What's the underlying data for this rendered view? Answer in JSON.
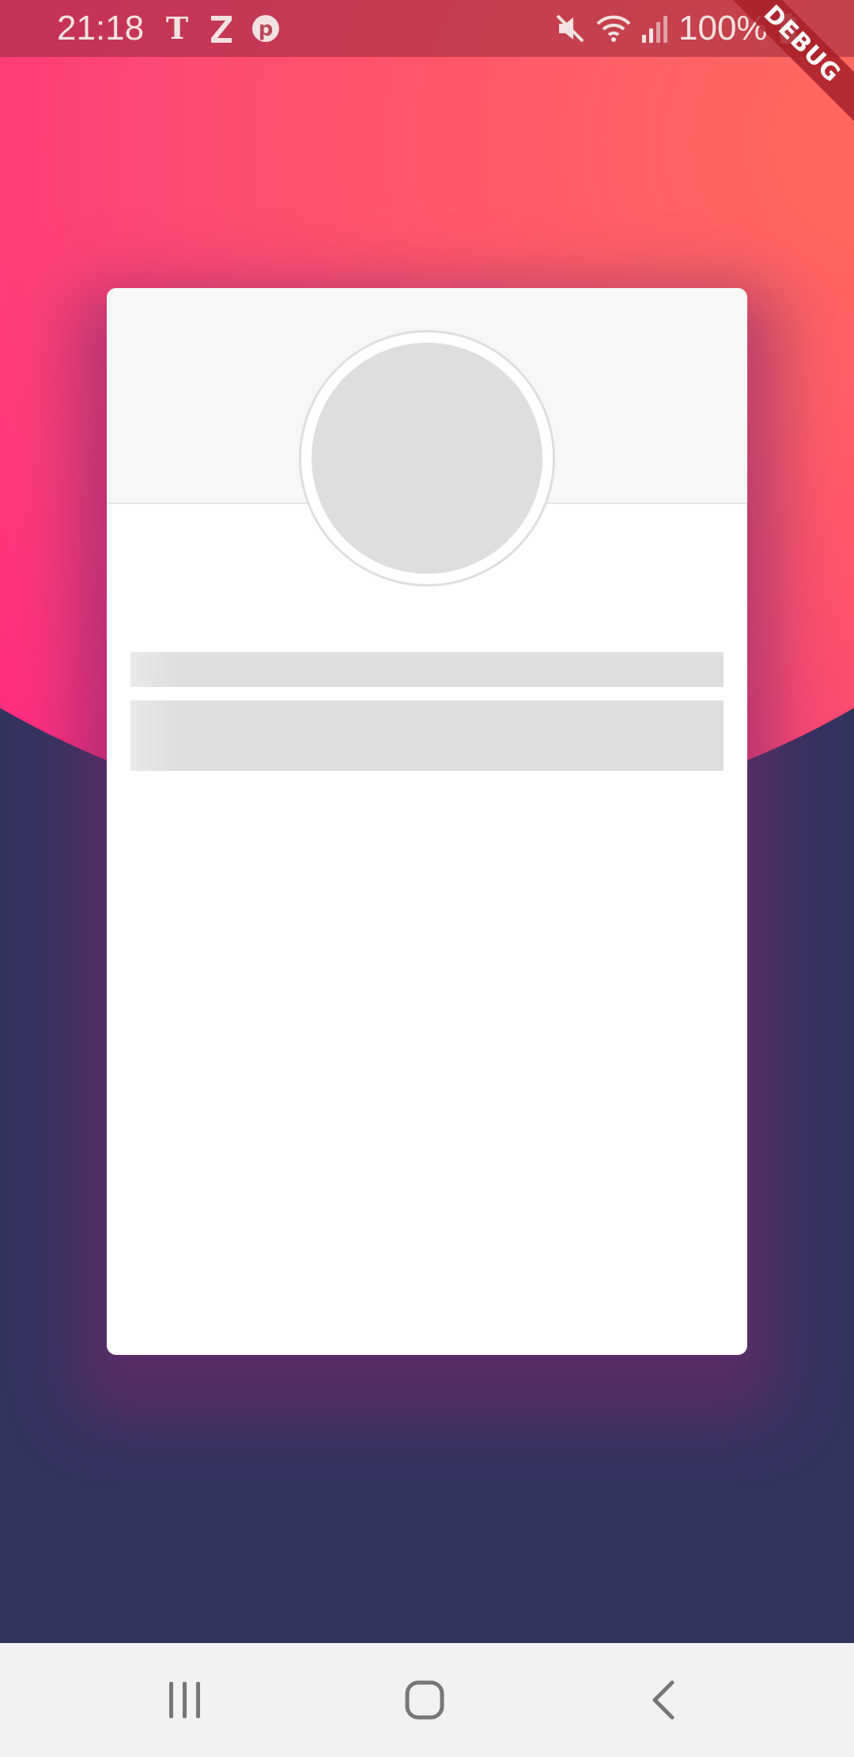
{
  "status_bar": {
    "time": "21:18",
    "battery": "100%",
    "notification_icons": [
      "nytimes-icon",
      "zedge-icon",
      "pinterest-icon"
    ],
    "system_icons": [
      "mute-icon",
      "wifi-icon",
      "signal-icon",
      "battery-icon"
    ]
  },
  "debug_banner": {
    "label": "DEBUG"
  },
  "colors": {
    "background_dark": "#333360",
    "gradient_warm": "#ff6b5c",
    "gradient_pink": "#ff2684",
    "card": "#ffffff",
    "skeleton": "#dedede",
    "nav_bar": "#f2f2f2"
  },
  "card": {
    "state": "loading",
    "placeholders": [
      "avatar",
      "title-line",
      "subtitle-block"
    ]
  },
  "nav_bar": {
    "buttons": [
      "recents",
      "home",
      "back"
    ]
  }
}
